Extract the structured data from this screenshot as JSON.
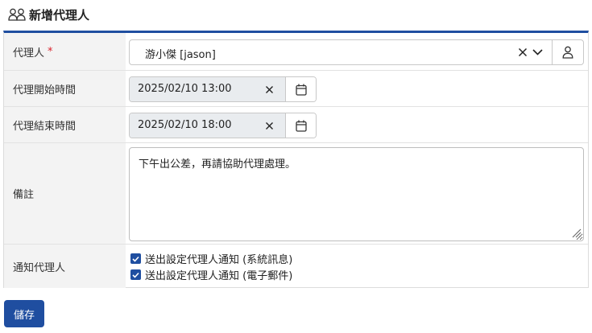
{
  "header": {
    "title": "新增代理人",
    "icon": "users-icon"
  },
  "form": {
    "agent": {
      "label": "代理人",
      "required_mark": "*",
      "value": "游小傑 [jason]"
    },
    "start_time": {
      "label": "代理開始時間",
      "value": "2025/02/10 13:00"
    },
    "end_time": {
      "label": "代理結束時間",
      "value": "2025/02/10 18:00"
    },
    "remark": {
      "label": "備註",
      "value": "下午出公差，再請協助代理處理。"
    },
    "notify": {
      "label": "通知代理人",
      "options": [
        {
          "label": "送出設定代理人通知 (系統訊息)",
          "checked": true
        },
        {
          "label": "送出設定代理人通知 (電子郵件)",
          "checked": true
        }
      ]
    }
  },
  "actions": {
    "save_label": "儲存"
  },
  "colors": {
    "accent": "#1f4ea0",
    "required": "#d9232d",
    "label_bg": "#f3f3f3",
    "readonly_bg": "#e9ecef"
  }
}
